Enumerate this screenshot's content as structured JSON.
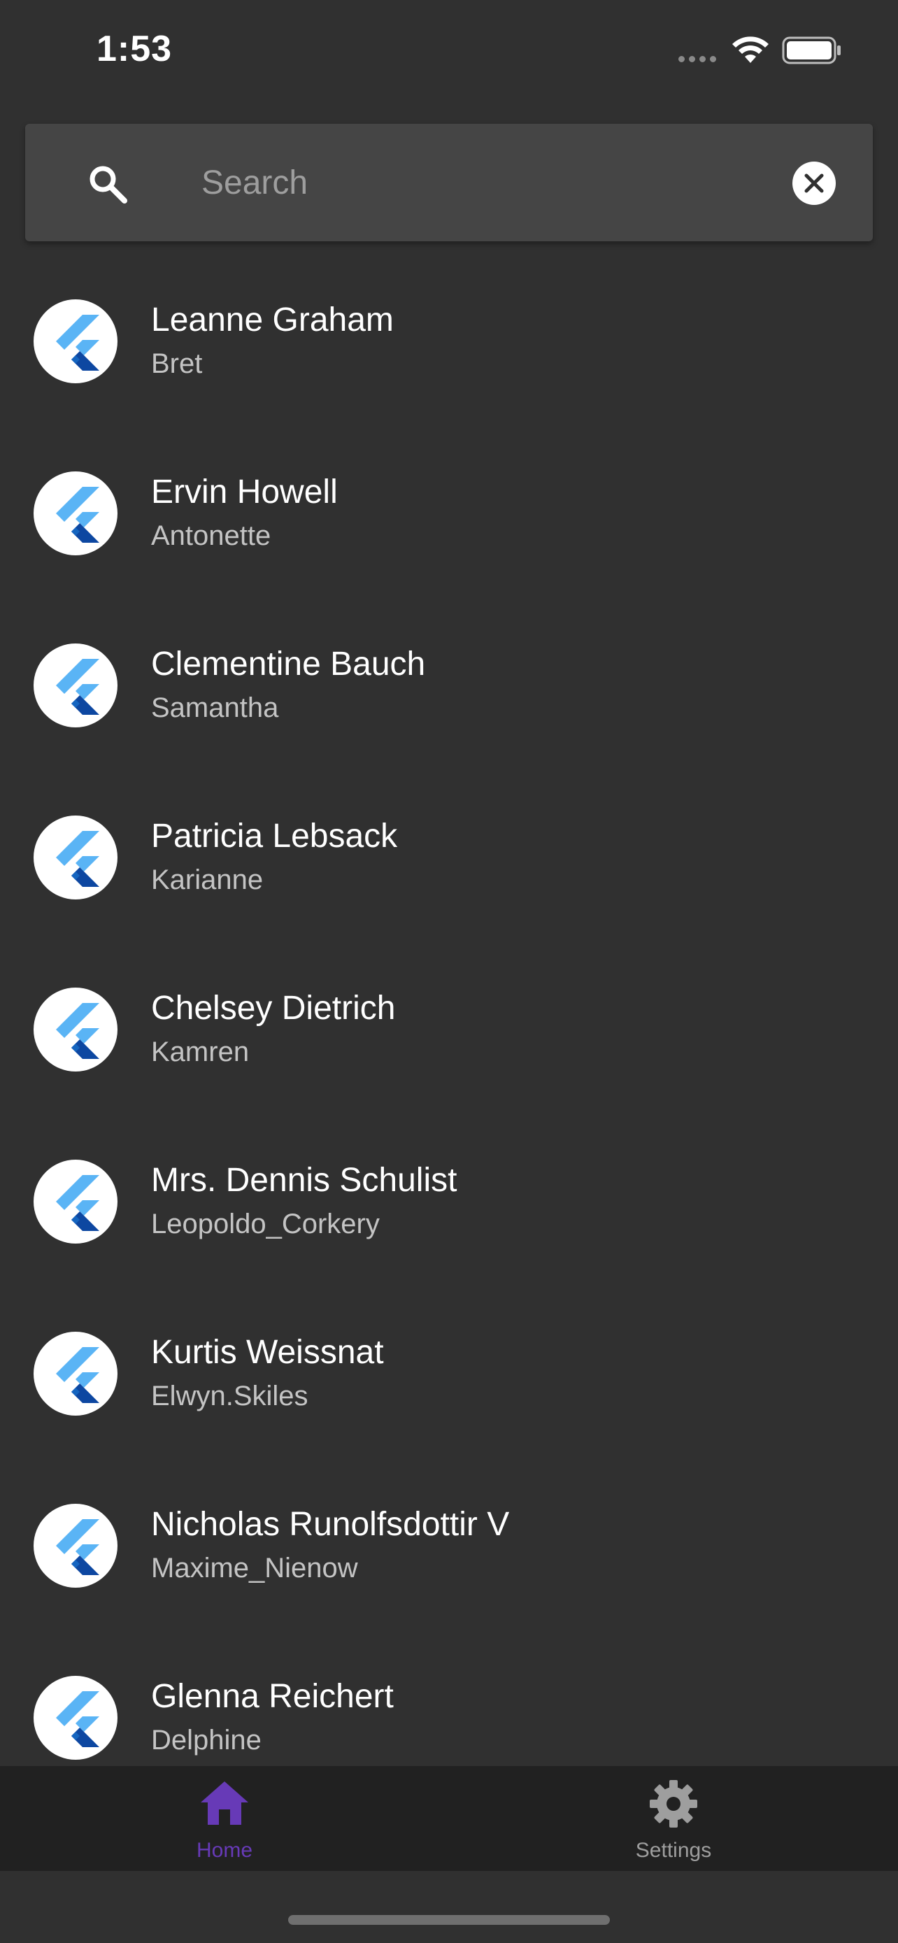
{
  "status_bar": {
    "time": "1:53"
  },
  "search": {
    "placeholder": "Search",
    "value": ""
  },
  "colors": {
    "background": "#303030",
    "search_background": "#454545",
    "nav_background": "#212121",
    "accent": "#673ab7",
    "inactive": "#9e9e9e",
    "avatar_logo_light": "#5ab4f5",
    "avatar_logo_dark": "#0d47a1"
  },
  "users": [
    {
      "name": "Leanne Graham",
      "username": "Bret",
      "icon": "flutter-logo-icon"
    },
    {
      "name": "Ervin Howell",
      "username": "Antonette",
      "icon": "flutter-logo-icon"
    },
    {
      "name": "Clementine Bauch",
      "username": "Samantha",
      "icon": "flutter-logo-icon"
    },
    {
      "name": "Patricia Lebsack",
      "username": "Karianne",
      "icon": "flutter-logo-icon"
    },
    {
      "name": "Chelsey Dietrich",
      "username": "Kamren",
      "icon": "flutter-logo-icon"
    },
    {
      "name": "Mrs. Dennis Schulist",
      "username": "Leopoldo_Corkery",
      "icon": "flutter-logo-icon"
    },
    {
      "name": "Kurtis Weissnat",
      "username": "Elwyn.Skiles",
      "icon": "flutter-logo-icon"
    },
    {
      "name": "Nicholas Runolfsdottir V",
      "username": "Maxime_Nienow",
      "icon": "flutter-logo-icon"
    },
    {
      "name": "Glenna Reichert",
      "username": "Delphine",
      "icon": "flutter-logo-icon"
    }
  ],
  "bottom_nav": {
    "items": [
      {
        "label": "Home",
        "icon": "home-icon",
        "active": true
      },
      {
        "label": "Settings",
        "icon": "gear-icon",
        "active": false
      }
    ]
  }
}
